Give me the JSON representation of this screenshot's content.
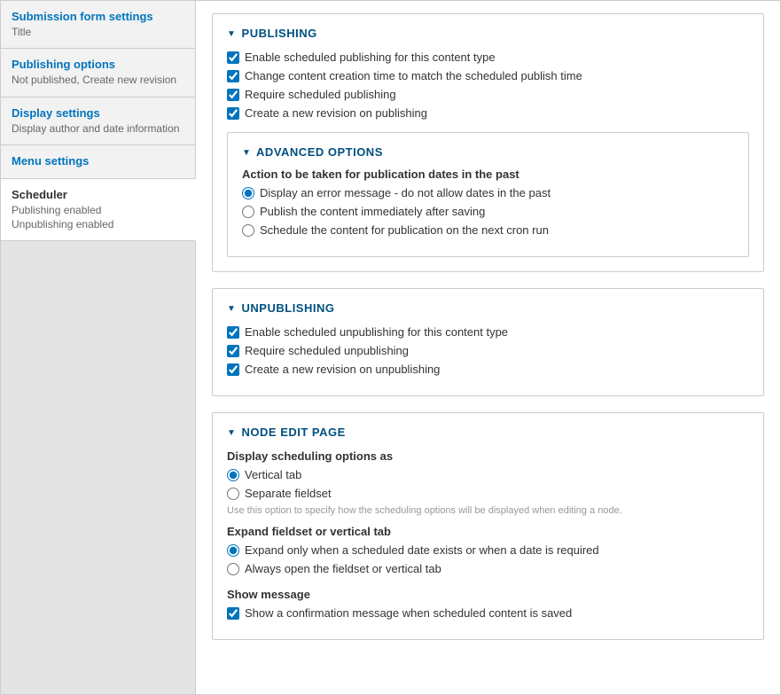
{
  "sidebar": {
    "tabs": [
      {
        "title": "Submission form settings",
        "summary": "Title"
      },
      {
        "title": "Publishing options",
        "summary": "Not published, Create new revision"
      },
      {
        "title": "Display settings",
        "summary": "Display author and date information"
      },
      {
        "title": "Menu settings",
        "summary": ""
      },
      {
        "title": "Scheduler",
        "summary": "Publishing enabled\nUnpublishing enabled"
      }
    ]
  },
  "publishing": {
    "legend": "PUBLISHING",
    "cb_enable": "Enable scheduled publishing for this content type",
    "cb_touch_time": "Change content creation time to match the scheduled publish time",
    "cb_require": "Require scheduled publishing",
    "cb_revision": "Create a new revision on publishing",
    "advanced": {
      "legend": "ADVANCED OPTIONS",
      "past_label": "Action to be taken for publication dates in the past",
      "past_opts": [
        "Display an error message - do not allow dates in the past",
        "Publish the content immediately after saving",
        "Schedule the content for publication on the next cron run"
      ]
    }
  },
  "unpublishing": {
    "legend": "UNPUBLISHING",
    "cb_enable": "Enable scheduled unpublishing for this content type",
    "cb_require": "Require scheduled unpublishing",
    "cb_revision": "Create a new revision on unpublishing"
  },
  "nodeedit": {
    "legend": "NODE EDIT PAGE",
    "display_label": "Display scheduling options as",
    "display_opts": [
      "Vertical tab",
      "Separate fieldset"
    ],
    "display_hint": "Use this option to specify how the scheduling options will be displayed when editing a node.",
    "expand_label": "Expand fieldset or vertical tab",
    "expand_opts": [
      "Expand only when a scheduled date exists or when a date is required",
      "Always open the fieldset or vertical tab"
    ],
    "showmsg_label": "Show message",
    "showmsg_cb": "Show a confirmation message when scheduled content is saved"
  }
}
